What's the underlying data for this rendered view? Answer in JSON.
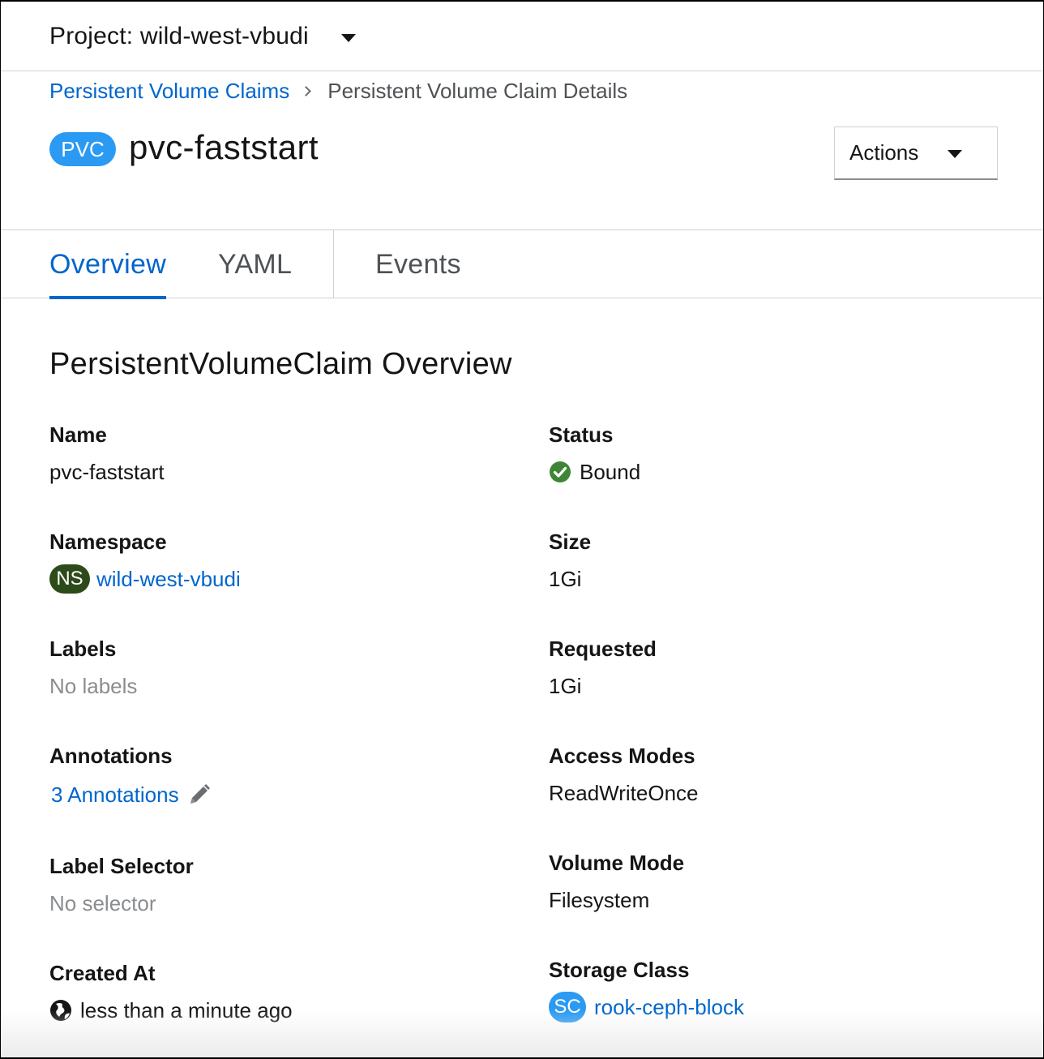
{
  "project_bar": {
    "label": "Project: wild-west-vbudi",
    "dropdown_icon": "caret-down-icon"
  },
  "breadcrumb": {
    "parent": "Persistent Volume Claims",
    "current": "Persistent Volume Claim Details"
  },
  "header": {
    "badge": "PVC",
    "title": "pvc-faststart",
    "actions_label": "Actions"
  },
  "tabs": [
    {
      "label": "Overview",
      "active": true
    },
    {
      "label": "YAML",
      "active": false
    },
    {
      "label": "Events",
      "active": false
    }
  ],
  "overview": {
    "title": "PersistentVolumeClaim Overview",
    "left": {
      "name": {
        "label": "Name",
        "value": "pvc-faststart"
      },
      "namespace": {
        "label": "Namespace",
        "badge": "NS",
        "value": "wild-west-vbudi"
      },
      "labels": {
        "label": "Labels",
        "value": "No labels"
      },
      "annotations": {
        "label": "Annotations",
        "value": "3 Annotations",
        "icon": "pencil-icon"
      },
      "label_selector": {
        "label": "Label Selector",
        "value": "No selector"
      },
      "created_at": {
        "label": "Created At",
        "value": "less than a minute ago",
        "icon": "globe-icon"
      }
    },
    "right": {
      "status": {
        "label": "Status",
        "value": "Bound",
        "icon": "check-circle-icon",
        "color": "#3e8635"
      },
      "size": {
        "label": "Size",
        "value": "1Gi"
      },
      "requested": {
        "label": "Requested",
        "value": "1Gi"
      },
      "access_modes": {
        "label": "Access Modes",
        "value": "ReadWriteOnce"
      },
      "volume_mode": {
        "label": "Volume Mode",
        "value": "Filesystem"
      },
      "storage_class": {
        "label": "Storage Class",
        "badge": "SC",
        "value": "rook-ceph-block"
      }
    }
  },
  "colors": {
    "link": "#0066cc",
    "pvc_badge": "#2b9af3",
    "ns_badge": "#2d4a1a",
    "status_ok": "#3e8635"
  }
}
